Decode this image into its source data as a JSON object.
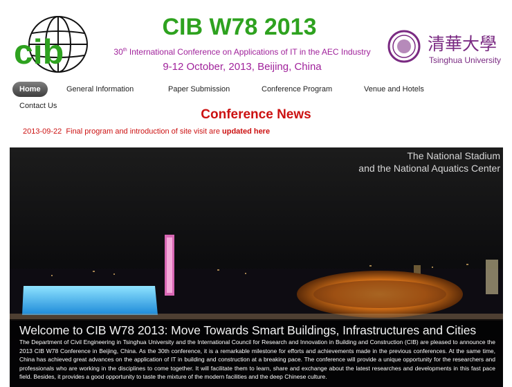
{
  "header": {
    "title": "CIB W78 2013",
    "subtitle_ordinal": "30",
    "subtitle_suffix": "th",
    "subtitle_rest": " International Conference on Applications of IT in the AEC Industry",
    "date_location": "9-12 October, 2013,  Beijing, China",
    "cib_logo_text": "cib",
    "tsinghua_cn": "清華大學",
    "tsinghua_en": "Tsinghua University"
  },
  "nav": {
    "items": [
      {
        "label": "Home",
        "active": true
      },
      {
        "label": "General Information"
      },
      {
        "label": "Paper Submission"
      },
      {
        "label": "Conference Program"
      },
      {
        "label": "Venue and Hotels"
      },
      {
        "label": "Contact Us"
      }
    ]
  },
  "news": {
    "heading": "Conference News",
    "date": "2013-09-22",
    "text": "Final program and introduction of site visit are ",
    "link": "updated here"
  },
  "hero": {
    "caption_line1": "The National Stadium",
    "caption_line2": "and the National Aquatics Center",
    "welcome_title": "Welcome to CIB W78 2013: Move Towards Smart Buildings, Infrastructures and Cities",
    "welcome_body": "The Department of Civil Engineering in Tsinghua University and the International Council for Research and Innovation in Building and Construction (CIB) are pleased to announce the 2013 CIB W78 Conference in Beijing, China. As the 30th conference, it is a remarkable milestone for efforts and achievements made in the previous conferences. At the same time, China has achieved great advances on the application of IT in building and construction at a breaking pace. The conference will provide a unique opportunity for the researchers and professionals who are working in the disciplines to come together. It will facilitate them to learn, share and exchange about the latest researches and developments in this fast pace field. Besides, it provides a good opportunity to taste the mixture of the modern facilities and the deep Chinese culture."
  },
  "colors": {
    "title_green": "#2ea21f",
    "subtitle_purple": "#a0229b",
    "news_red": "#cc1111",
    "tsinghua_purple": "#7a2a82"
  }
}
